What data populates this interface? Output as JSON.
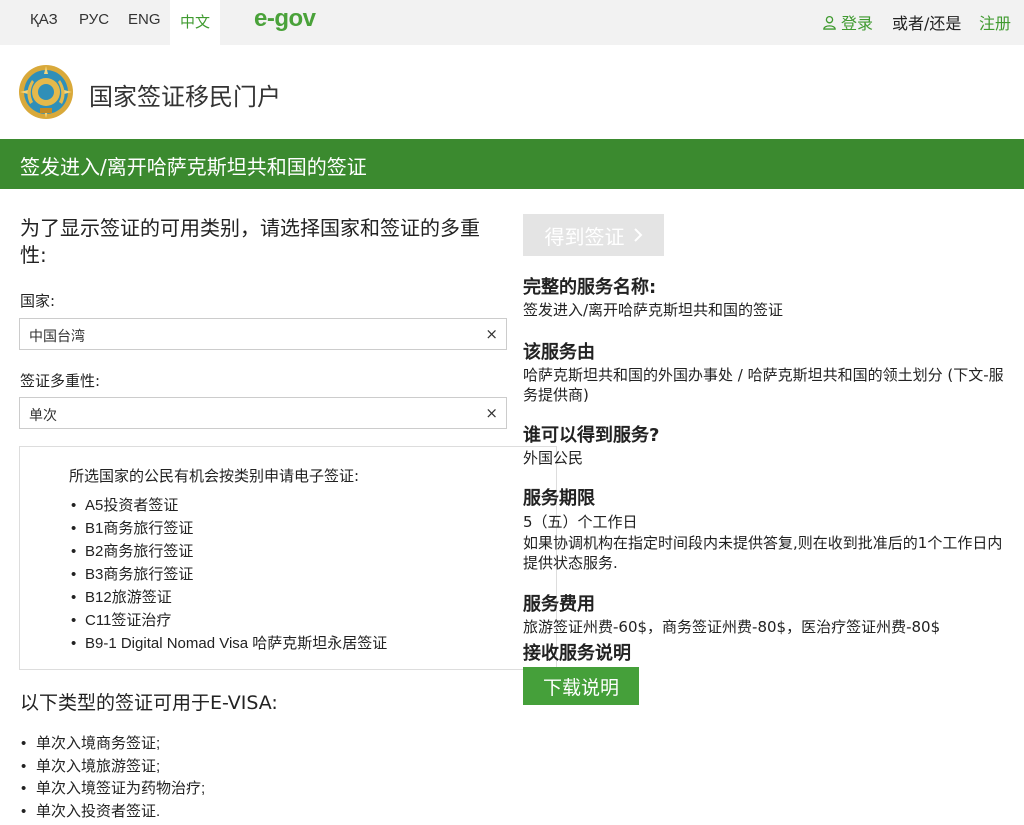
{
  "topbar": {
    "languages": [
      "ҚАЗ",
      "РУС",
      "ENG",
      "中文"
    ],
    "logo": "e-gov",
    "login": "登录",
    "or": "或者/还是",
    "register": "注册"
  },
  "header": {
    "portal_title": "国家签证移民门户"
  },
  "band": {
    "title": "签发进入/离开哈萨克斯坦共和国的签证"
  },
  "form": {
    "prompt": "为了显示签证的可用类别，请选择国家和签证的多重性:",
    "country_label": "国家:",
    "country_value": "中国台湾",
    "multiplicity_label": "签证多重性:",
    "multiplicity_value": "单次",
    "clear_glyph": "×"
  },
  "infobox": {
    "heading": "所选国家的公民有机会按类别申请电子签证:",
    "items": [
      "A5投资者签证",
      "B1商务旅行签证",
      "B2商务旅行签证",
      "B3商务旅行签证",
      "B12旅游签证",
      "C11签证治疗",
      "B9-1 Digital Nomad Visa 哈萨克斯坦永居签证"
    ]
  },
  "evisa": {
    "title": "以下类型的签证可用于E-VISA:",
    "items": [
      "单次入境商务签证;",
      "单次入境旅游签证;",
      "单次入境签证为药物治疗;",
      "单次入投资者签证."
    ]
  },
  "service": {
    "get_visa_button": "得到签证",
    "full_name_title": "完整的服务名称:",
    "full_name": "签发进入/离开哈萨克斯坦共和国的签证",
    "provider_title": "该服务由",
    "provider": "哈萨克斯坦共和国的外国办事处 / 哈萨克斯坦共和国的领土划分 (下文-服务提供商)",
    "who_title": "谁可以得到服务?",
    "who": "外国公民",
    "term_title": "服务期限",
    "term_line1": "5（五）个工作日",
    "term_line2": "如果协调机构在指定时间段内未提供答复,则在收到批准后的1个工作日内提供状态服务.",
    "fee_title": "服务费用",
    "fee": "旅游签证州费-60$，商务签证州费-80$，医治疗签证州费-80$",
    "instructions_title": "接收服务说明",
    "download_button": "下载说明"
  }
}
